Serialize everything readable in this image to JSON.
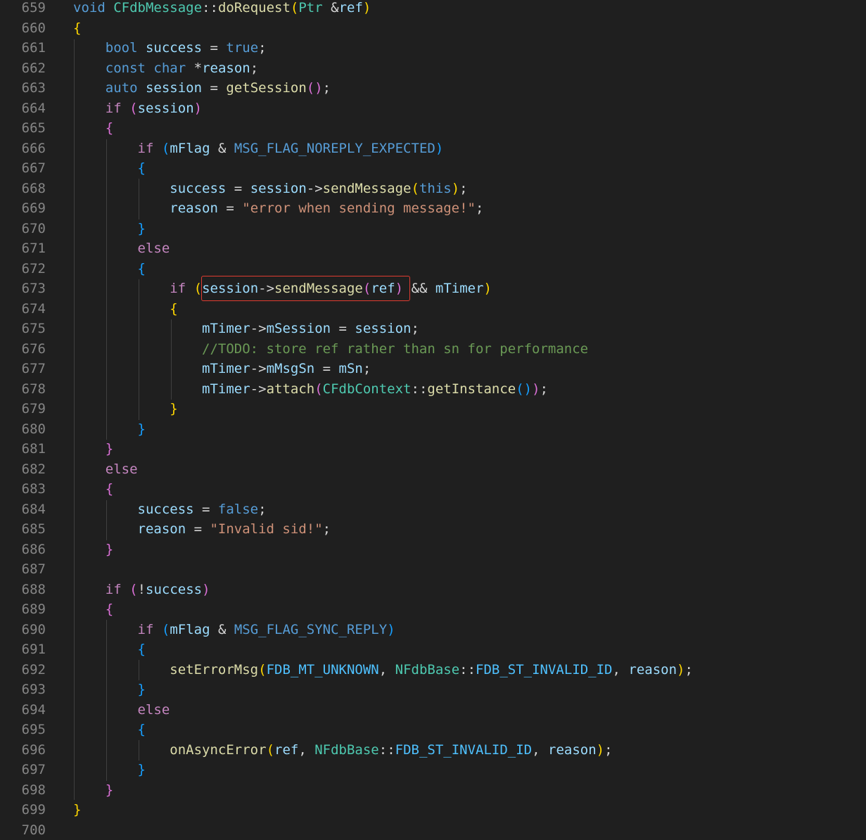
{
  "editor": {
    "colors": {
      "background": "#1f1f1f",
      "line_number": "#858585",
      "keyword": "#569cd6",
      "control": "#c586c0",
      "type": "#4ec9b0",
      "function": "#dcdcaa",
      "variable": "#9cdcfe",
      "constant": "#4fc1ff",
      "string": "#ce9178",
      "comment": "#6a9955",
      "bracket_level_1": "#ffd700",
      "bracket_level_2": "#da70d6",
      "bracket_level_3": "#179fff",
      "highlight_box": "#e03c31"
    },
    "lines": [
      {
        "n": "659",
        "tokens": [
          [
            "void",
            "kw"
          ],
          [
            " ",
            ""
          ],
          [
            "CFdbMessage",
            "typ"
          ],
          [
            "::",
            "op"
          ],
          [
            "doRequest",
            "fn"
          ],
          [
            "(",
            "p1"
          ],
          [
            "Ptr",
            "typ"
          ],
          [
            " ",
            ""
          ],
          [
            "&",
            "op"
          ],
          [
            "ref",
            "var"
          ],
          [
            ")",
            "p1"
          ]
        ]
      },
      {
        "n": "660",
        "tokens": [
          [
            "{",
            "p1"
          ]
        ]
      },
      {
        "n": "661",
        "tokens": [
          [
            "    ",
            ""
          ],
          [
            "bool",
            "kw"
          ],
          [
            " ",
            ""
          ],
          [
            "success",
            "var"
          ],
          [
            " = ",
            "op"
          ],
          [
            "true",
            "kw"
          ],
          [
            ";",
            "op"
          ]
        ]
      },
      {
        "n": "662",
        "tokens": [
          [
            "    ",
            ""
          ],
          [
            "const",
            "kw"
          ],
          [
            " ",
            ""
          ],
          [
            "char",
            "kw"
          ],
          [
            " ",
            ""
          ],
          [
            "*",
            "op"
          ],
          [
            "reason",
            "var"
          ],
          [
            ";",
            "op"
          ]
        ]
      },
      {
        "n": "663",
        "tokens": [
          [
            "    ",
            ""
          ],
          [
            "auto",
            "kw"
          ],
          [
            " ",
            ""
          ],
          [
            "session",
            "var"
          ],
          [
            " = ",
            "op"
          ],
          [
            "getSession",
            "fn"
          ],
          [
            "()",
            "p2"
          ],
          [
            ";",
            "op"
          ]
        ]
      },
      {
        "n": "664",
        "tokens": [
          [
            "    ",
            ""
          ],
          [
            "if",
            "ctl"
          ],
          [
            " ",
            ""
          ],
          [
            "(",
            "p2"
          ],
          [
            "session",
            "var"
          ],
          [
            ")",
            "p2"
          ]
        ]
      },
      {
        "n": "665",
        "tokens": [
          [
            "    ",
            ""
          ],
          [
            "{",
            "p2"
          ]
        ]
      },
      {
        "n": "666",
        "tokens": [
          [
            "        ",
            ""
          ],
          [
            "if",
            "ctl"
          ],
          [
            " ",
            ""
          ],
          [
            "(",
            "p3"
          ],
          [
            "mFlag",
            "var"
          ],
          [
            " & ",
            "op"
          ],
          [
            "MSG_FLAG_NOREPLY_EXPECTED",
            "mac"
          ],
          [
            ")",
            "p3"
          ]
        ]
      },
      {
        "n": "667",
        "tokens": [
          [
            "        ",
            ""
          ],
          [
            "{",
            "p3"
          ]
        ]
      },
      {
        "n": "668",
        "tokens": [
          [
            "            ",
            ""
          ],
          [
            "success",
            "var"
          ],
          [
            " = ",
            "op"
          ],
          [
            "session",
            "var"
          ],
          [
            "->",
            "op"
          ],
          [
            "sendMessage",
            "fn"
          ],
          [
            "(",
            "p1"
          ],
          [
            "this",
            "kw"
          ],
          [
            ")",
            "p1"
          ],
          [
            ";",
            "op"
          ]
        ]
      },
      {
        "n": "669",
        "tokens": [
          [
            "            ",
            ""
          ],
          [
            "reason",
            "var"
          ],
          [
            " = ",
            "op"
          ],
          [
            "\"error when sending message!\"",
            "str"
          ],
          [
            ";",
            "op"
          ]
        ]
      },
      {
        "n": "670",
        "tokens": [
          [
            "        ",
            ""
          ],
          [
            "}",
            "p3"
          ]
        ]
      },
      {
        "n": "671",
        "tokens": [
          [
            "        ",
            ""
          ],
          [
            "else",
            "ctl"
          ]
        ]
      },
      {
        "n": "672",
        "tokens": [
          [
            "        ",
            ""
          ],
          [
            "{",
            "p3"
          ]
        ]
      },
      {
        "n": "673",
        "tokens": [
          [
            "            ",
            ""
          ],
          [
            "if",
            "ctl"
          ],
          [
            " ",
            ""
          ],
          [
            "(",
            "p1"
          ],
          [
            "session",
            "var"
          ],
          [
            "->",
            "op"
          ],
          [
            "sendMessage",
            "fn"
          ],
          [
            "(",
            "p2"
          ],
          [
            "ref",
            "var"
          ],
          [
            ")",
            "p2"
          ],
          [
            " && ",
            "op"
          ],
          [
            "mTimer",
            "var"
          ],
          [
            ")",
            "p1"
          ]
        ]
      },
      {
        "n": "674",
        "tokens": [
          [
            "            ",
            ""
          ],
          [
            "{",
            "p1"
          ]
        ]
      },
      {
        "n": "675",
        "tokens": [
          [
            "                ",
            ""
          ],
          [
            "mTimer",
            "var"
          ],
          [
            "->",
            "op"
          ],
          [
            "mSession",
            "var"
          ],
          [
            " = ",
            "op"
          ],
          [
            "session",
            "var"
          ],
          [
            ";",
            "op"
          ]
        ]
      },
      {
        "n": "676",
        "tokens": [
          [
            "                ",
            ""
          ],
          [
            "//TODO: store ref rather than sn for performance",
            "com"
          ]
        ]
      },
      {
        "n": "677",
        "tokens": [
          [
            "                ",
            ""
          ],
          [
            "mTimer",
            "var"
          ],
          [
            "->",
            "op"
          ],
          [
            "mMsgSn",
            "var"
          ],
          [
            " = ",
            "op"
          ],
          [
            "mSn",
            "var"
          ],
          [
            ";",
            "op"
          ]
        ]
      },
      {
        "n": "678",
        "tokens": [
          [
            "                ",
            ""
          ],
          [
            "mTimer",
            "var"
          ],
          [
            "->",
            "op"
          ],
          [
            "attach",
            "fn"
          ],
          [
            "(",
            "p2"
          ],
          [
            "CFdbContext",
            "typ"
          ],
          [
            "::",
            "op"
          ],
          [
            "getInstance",
            "fn"
          ],
          [
            "()",
            "p3"
          ],
          [
            ")",
            "p2"
          ],
          [
            ";",
            "op"
          ]
        ]
      },
      {
        "n": "679",
        "tokens": [
          [
            "            ",
            ""
          ],
          [
            "}",
            "p1"
          ]
        ]
      },
      {
        "n": "680",
        "tokens": [
          [
            "        ",
            ""
          ],
          [
            "}",
            "p3"
          ]
        ]
      },
      {
        "n": "681",
        "tokens": [
          [
            "    ",
            ""
          ],
          [
            "}",
            "p2"
          ]
        ]
      },
      {
        "n": "682",
        "tokens": [
          [
            "    ",
            ""
          ],
          [
            "else",
            "ctl"
          ]
        ]
      },
      {
        "n": "683",
        "tokens": [
          [
            "    ",
            ""
          ],
          [
            "{",
            "p2"
          ]
        ]
      },
      {
        "n": "684",
        "tokens": [
          [
            "        ",
            ""
          ],
          [
            "success",
            "var"
          ],
          [
            " = ",
            "op"
          ],
          [
            "false",
            "kw"
          ],
          [
            ";",
            "op"
          ]
        ]
      },
      {
        "n": "685",
        "tokens": [
          [
            "        ",
            ""
          ],
          [
            "reason",
            "var"
          ],
          [
            " = ",
            "op"
          ],
          [
            "\"Invalid sid!\"",
            "str"
          ],
          [
            ";",
            "op"
          ]
        ]
      },
      {
        "n": "686",
        "tokens": [
          [
            "    ",
            ""
          ],
          [
            "}",
            "p2"
          ]
        ]
      },
      {
        "n": "687",
        "tokens": []
      },
      {
        "n": "688",
        "tokens": [
          [
            "    ",
            ""
          ],
          [
            "if",
            "ctl"
          ],
          [
            " ",
            ""
          ],
          [
            "(",
            "p2"
          ],
          [
            "!",
            "op"
          ],
          [
            "success",
            "var"
          ],
          [
            ")",
            "p2"
          ]
        ]
      },
      {
        "n": "689",
        "tokens": [
          [
            "    ",
            ""
          ],
          [
            "{",
            "p2"
          ]
        ]
      },
      {
        "n": "690",
        "tokens": [
          [
            "        ",
            ""
          ],
          [
            "if",
            "ctl"
          ],
          [
            " ",
            ""
          ],
          [
            "(",
            "p3"
          ],
          [
            "mFlag",
            "var"
          ],
          [
            " & ",
            "op"
          ],
          [
            "MSG_FLAG_SYNC_REPLY",
            "mac"
          ],
          [
            ")",
            "p3"
          ]
        ]
      },
      {
        "n": "691",
        "tokens": [
          [
            "        ",
            ""
          ],
          [
            "{",
            "p3"
          ]
        ]
      },
      {
        "n": "692",
        "tokens": [
          [
            "            ",
            ""
          ],
          [
            "setErrorMsg",
            "fn"
          ],
          [
            "(",
            "p1"
          ],
          [
            "FDB_MT_UNKNOWN",
            "const"
          ],
          [
            ", ",
            "op"
          ],
          [
            "NFdbBase",
            "typ"
          ],
          [
            "::",
            "op"
          ],
          [
            "FDB_ST_INVALID_ID",
            "const"
          ],
          [
            ", ",
            "op"
          ],
          [
            "reason",
            "var"
          ],
          [
            ")",
            "p1"
          ],
          [
            ";",
            "op"
          ]
        ]
      },
      {
        "n": "693",
        "tokens": [
          [
            "        ",
            ""
          ],
          [
            "}",
            "p3"
          ]
        ]
      },
      {
        "n": "694",
        "tokens": [
          [
            "        ",
            ""
          ],
          [
            "else",
            "ctl"
          ]
        ]
      },
      {
        "n": "695",
        "tokens": [
          [
            "        ",
            ""
          ],
          [
            "{",
            "p3"
          ]
        ]
      },
      {
        "n": "696",
        "tokens": [
          [
            "            ",
            ""
          ],
          [
            "onAsyncError",
            "fn"
          ],
          [
            "(",
            "p1"
          ],
          [
            "ref",
            "var"
          ],
          [
            ", ",
            "op"
          ],
          [
            "NFdbBase",
            "typ"
          ],
          [
            "::",
            "op"
          ],
          [
            "FDB_ST_INVALID_ID",
            "const"
          ],
          [
            ", ",
            "op"
          ],
          [
            "reason",
            "var"
          ],
          [
            ")",
            "p1"
          ],
          [
            ";",
            "op"
          ]
        ]
      },
      {
        "n": "697",
        "tokens": [
          [
            "        ",
            ""
          ],
          [
            "}",
            "p3"
          ]
        ]
      },
      {
        "n": "698",
        "tokens": [
          [
            "    ",
            ""
          ],
          [
            "}",
            "p2"
          ]
        ]
      },
      {
        "n": "699",
        "tokens": [
          [
            "}",
            "p1"
          ]
        ]
      },
      {
        "n": "700",
        "tokens": []
      }
    ]
  }
}
